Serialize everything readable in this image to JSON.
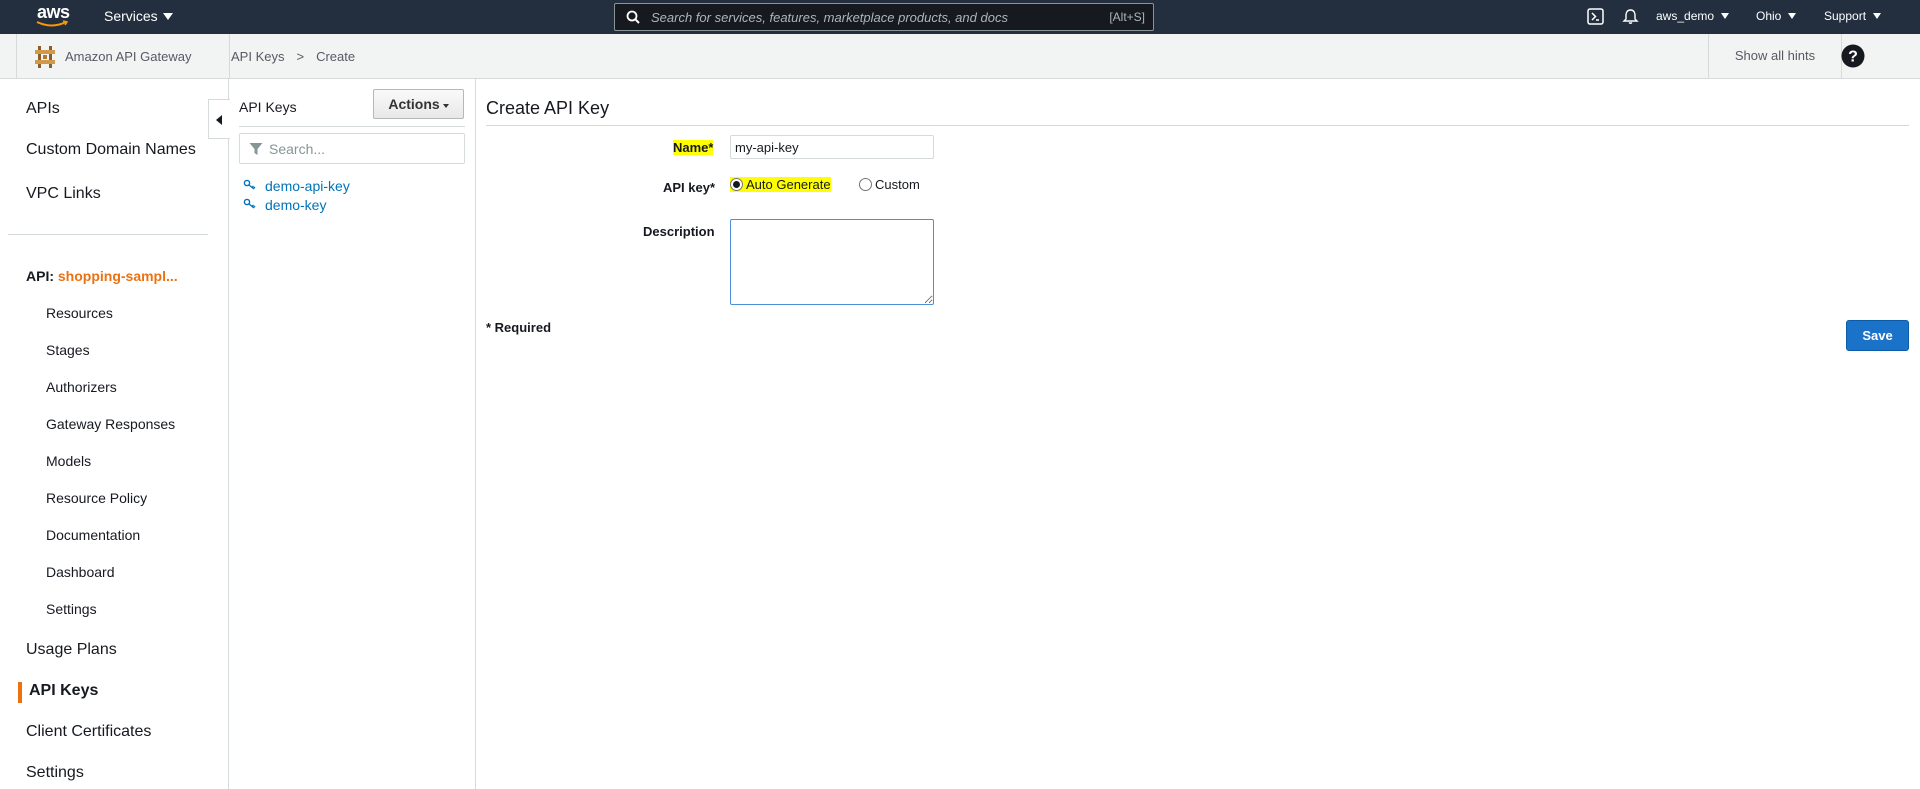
{
  "topnav": {
    "logo": "aws",
    "services": "Services",
    "search_placeholder": "Search for services, features, marketplace products, and docs",
    "search_shortcut": "[Alt+S]",
    "user": "aws_demo",
    "region": "Ohio",
    "support": "Support",
    "icons": [
      "cloudshell-icon",
      "bell-icon",
      "search-icon"
    ]
  },
  "subheader": {
    "service_name": "Amazon API Gateway",
    "breadcrumb": [
      "API Keys",
      "Create"
    ],
    "breadcrumb_sep": ">",
    "show_hints": "Show all hints",
    "help": "?"
  },
  "leftnav": {
    "top_items": [
      "APIs",
      "Custom Domain Names",
      "VPC Links"
    ],
    "api_prefix": "API:",
    "api_name": "shopping-sampl...",
    "api_items": [
      "Resources",
      "Stages",
      "Authorizers",
      "Gateway Responses",
      "Models",
      "Resource Policy",
      "Documentation",
      "Dashboard",
      "Settings"
    ],
    "bottom_items": [
      "Usage Plans",
      "API Keys",
      "Client Certificates",
      "Settings"
    ],
    "active": "API Keys"
  },
  "midpanel": {
    "title": "API Keys",
    "actions": "Actions",
    "search_placeholder": "Search...",
    "keys": [
      "demo-api-key",
      "demo-key"
    ]
  },
  "form": {
    "title": "Create API Key",
    "name_label": "Name",
    "name_value": "my-api-key",
    "apikey_label": "API key",
    "required_star": "*",
    "option_auto": "Auto Generate",
    "option_custom": "Custom",
    "selected_option": "Auto Generate",
    "description_label": "Description",
    "description_value": "",
    "required_note": "* Required",
    "save": "Save"
  },
  "colors": {
    "topnav_bg": "#232f3e",
    "accent_orange": "#ec7211",
    "link_blue": "#0073bb",
    "save_blue": "#1a73c8",
    "highlight": "#ffff00"
  }
}
